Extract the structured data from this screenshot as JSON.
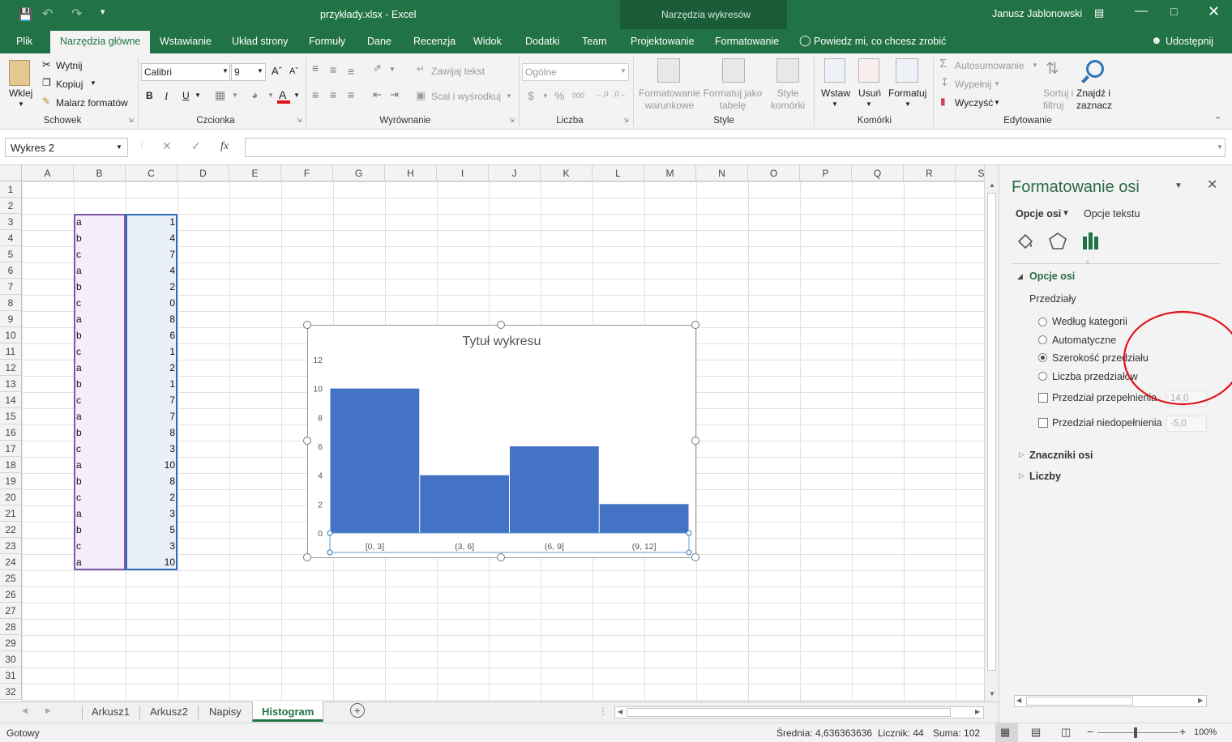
{
  "title_bar": {
    "title": "przykłady.xlsx  -  Excel",
    "context_group": "Narzędzia wykresów",
    "user": "Janusz Jablonowski"
  },
  "tabs": [
    "Plik",
    "Narzędzia główne",
    "Wstawianie",
    "Układ strony",
    "Formuły",
    "Dane",
    "Recenzja",
    "Widok",
    "Dodatki",
    "Team",
    "Projektowanie",
    "Formatowanie"
  ],
  "tell_me": "Powiedz mi, co chcesz zrobić",
  "share": "Udostępnij",
  "ribbon": {
    "clipboard": {
      "label": "Schowek",
      "paste": "Wklej",
      "cut": "Wytnij",
      "copy": "Kopiuj",
      "format_painter": "Malarz formatów"
    },
    "font": {
      "label": "Czcionka",
      "font_name": "Calibri",
      "font_size": "9",
      "bold": "B",
      "italic": "I",
      "underline": "U"
    },
    "alignment": {
      "label": "Wyrównanie",
      "wrap": "Zawijaj tekst",
      "merge": "Scal i wyśrodkuj"
    },
    "number": {
      "label": "Liczba",
      "format": "Ogólne"
    },
    "styles": {
      "label": "Style",
      "conditional": "Formatowanie warunkowe",
      "as_table": "Formatuj jako tabelę",
      "cell_styles": "Style komórki"
    },
    "cells": {
      "label": "Komórki",
      "insert": "Wstaw",
      "delete": "Usuń",
      "format": "Formatuj"
    },
    "editing": {
      "label": "Edytowanie",
      "autosum": "Autosumowanie",
      "fill": "Wypełnij",
      "clear": "Wyczyść",
      "sort": "Sortuj i filtruj",
      "find": "Znajdź i zaznacz"
    }
  },
  "formula_bar": {
    "name_box": "Wykres 2",
    "fx": "fx",
    "formula": ""
  },
  "columns": [
    "A",
    "B",
    "C",
    "D",
    "E",
    "F",
    "G",
    "H",
    "I",
    "J",
    "K",
    "L",
    "M",
    "N",
    "O",
    "P",
    "Q",
    "R",
    "S"
  ],
  "rows": [
    "1",
    "2",
    "3",
    "4",
    "5",
    "6",
    "7",
    "8",
    "9",
    "10",
    "11",
    "12",
    "13",
    "14",
    "15",
    "16",
    "17",
    "18",
    "19",
    "20",
    "21",
    "22",
    "23",
    "24",
    "25",
    "26",
    "27",
    "28",
    "29",
    "30",
    "31",
    "32"
  ],
  "data_rows": [
    {
      "b": "a",
      "c": "1"
    },
    {
      "b": "b",
      "c": "4"
    },
    {
      "b": "c",
      "c": "7"
    },
    {
      "b": "a",
      "c": "4"
    },
    {
      "b": "b",
      "c": "2"
    },
    {
      "b": "c",
      "c": "0"
    },
    {
      "b": "a",
      "c": "8"
    },
    {
      "b": "b",
      "c": "6"
    },
    {
      "b": "c",
      "c": "1"
    },
    {
      "b": "a",
      "c": "2"
    },
    {
      "b": "b",
      "c": "1"
    },
    {
      "b": "c",
      "c": "7"
    },
    {
      "b": "a",
      "c": "7"
    },
    {
      "b": "b",
      "c": "8"
    },
    {
      "b": "c",
      "c": "3"
    },
    {
      "b": "a",
      "c": "10"
    },
    {
      "b": "b",
      "c": "8"
    },
    {
      "b": "c",
      "c": "2"
    },
    {
      "b": "a",
      "c": "3"
    },
    {
      "b": "b",
      "c": "5"
    },
    {
      "b": "c",
      "c": "3"
    },
    {
      "b": "a",
      "c": "10"
    }
  ],
  "chart_data": {
    "type": "bar",
    "title": "Tytuł wykresu",
    "categories": [
      "[0, 3]",
      "(3, 6]",
      "(6, 9]",
      "(9, 12]"
    ],
    "values": [
      10,
      4,
      6,
      2
    ],
    "ylim": [
      0,
      12
    ],
    "yticks": [
      "0",
      "2",
      "4",
      "6",
      "8",
      "10",
      "12"
    ],
    "bar_color": "#4472C4",
    "grid": false,
    "legend": "none"
  },
  "sheet_tabs": [
    "Arkusz1",
    "Arkusz2",
    "Napisy",
    "Histogram"
  ],
  "active_sheet": "Histogram",
  "status": {
    "ready": "Gotowy",
    "average": "Średnia: 4,636363636",
    "count": "Licznik: 44",
    "sum": "Suma: 102",
    "zoom": "100%"
  },
  "pane": {
    "title": "Formatowanie osi",
    "tab_axis": "Opcje osi",
    "tab_text": "Opcje tekstu",
    "section_axis": "Opcje osi",
    "bins_label": "Przedziały",
    "opt_by_category": "Według kategorii",
    "opt_auto": "Automatyczne",
    "opt_bin_width": "Szerokość przedziału",
    "opt_bin_count": "Liczba przedziałów",
    "overflow_label": "Przedział przepełnienia",
    "overflow_value": "14,0",
    "underflow_label": "Przedział niedopełnienia",
    "underflow_value": "-5,0",
    "section_ticks": "Znaczniki osi",
    "section_numbers": "Liczby"
  },
  "colors": {
    "excel_green": "#217346",
    "selection_b": "#7e57a8",
    "selection_c": "#2e6dbf",
    "annotation_red": "#e0121b"
  }
}
